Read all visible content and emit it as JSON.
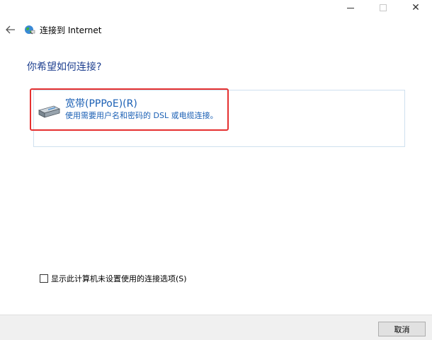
{
  "window": {
    "controls": {
      "minimize": "minimize",
      "maximize": "maximize",
      "close": "✕"
    }
  },
  "nav": {
    "back_icon": "back-arrow-icon",
    "app_icon": "network-globe-icon",
    "title": "连接到 Internet"
  },
  "main": {
    "heading": "你希望如何连接?",
    "options": [
      {
        "icon": "modem-icon",
        "title": "宽带(PPPoE)(R)",
        "description": "使用需要用户名和密码的 DSL 或电缆连接。",
        "highlighted": true
      }
    ]
  },
  "options_checkbox": {
    "checked": false,
    "label": "显示此计算机未设置使用的连接选项(S)"
  },
  "footer": {
    "cancel_label": "取消"
  },
  "colors": {
    "heading": "#1e3f8f",
    "link": "#1a5fb4",
    "highlight": "#e53030",
    "footer_bg": "#f0f0f0"
  }
}
